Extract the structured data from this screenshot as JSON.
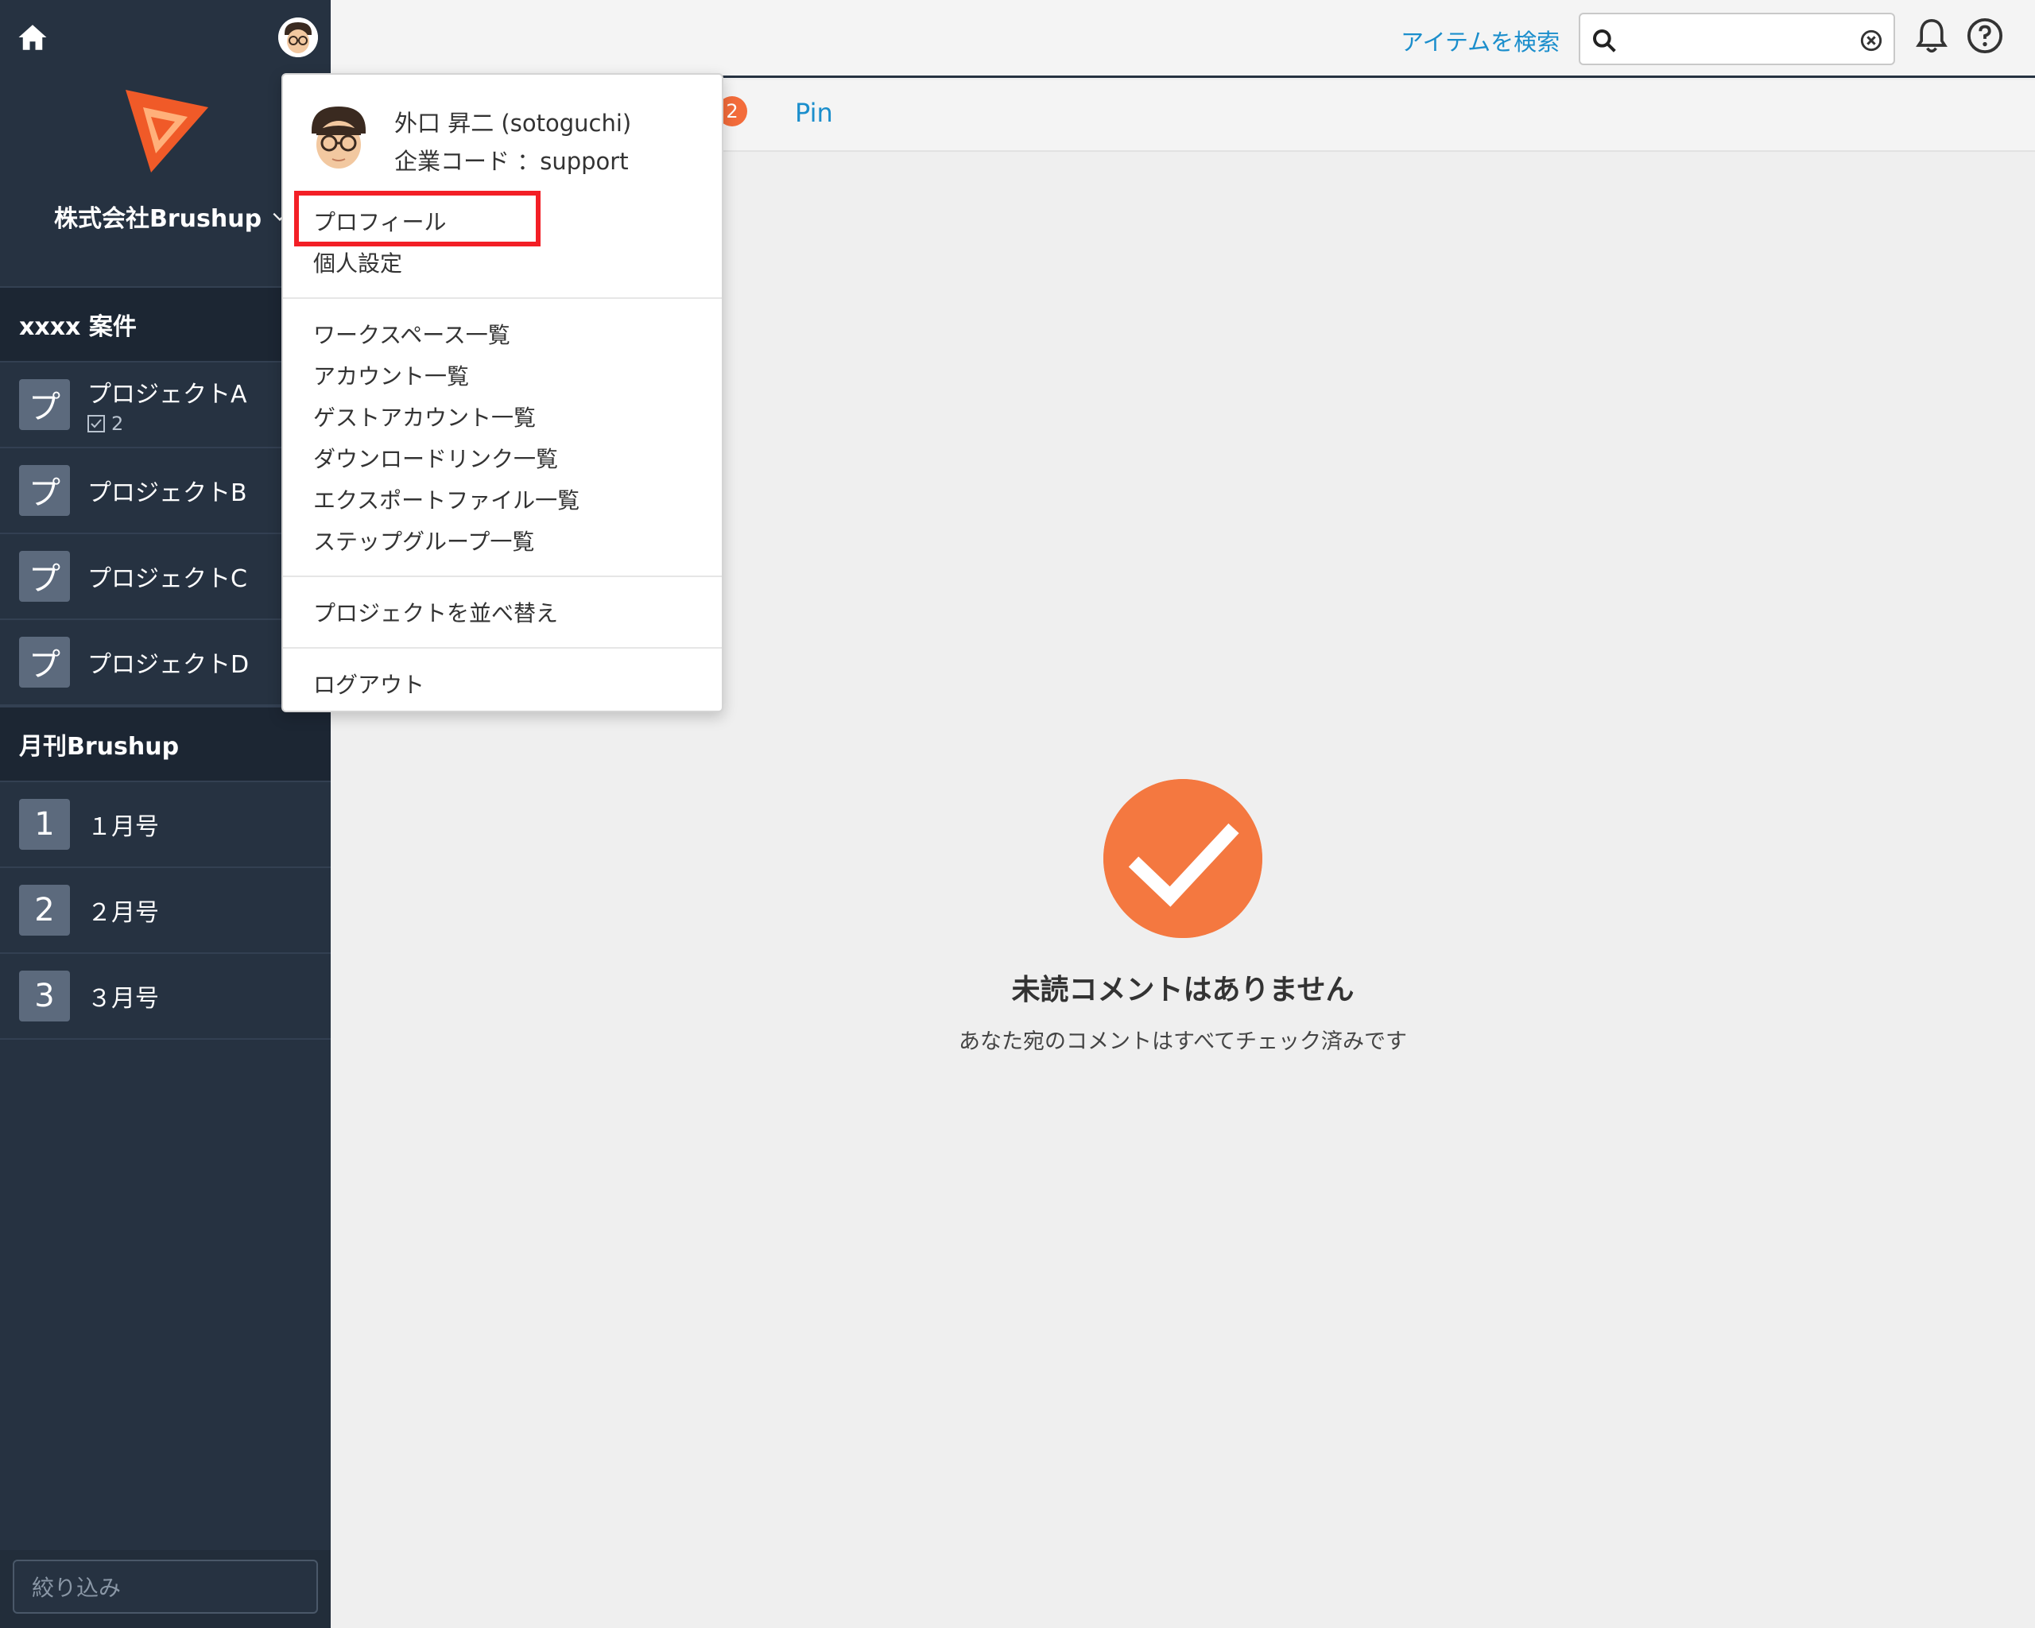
{
  "header": {
    "search_link": "アイテムを検索",
    "search": {
      "value": "",
      "placeholder": ""
    }
  },
  "sidebar": {
    "company": "株式会社Brushup",
    "sections": [
      {
        "title": "xxxx 案件",
        "items": [
          {
            "badge": "プ",
            "label": "プロジェクトA",
            "sub_count": "2"
          },
          {
            "badge": "プ",
            "label": "プロジェクトB"
          },
          {
            "badge": "プ",
            "label": "プロジェクトC"
          },
          {
            "badge": "プ",
            "label": "プロジェクトD"
          }
        ]
      },
      {
        "title": "月刊Brushup",
        "items": [
          {
            "badge": "1",
            "label": "１月号"
          },
          {
            "badge": "2",
            "label": "２月号"
          },
          {
            "badge": "3",
            "label": "３月号"
          }
        ]
      }
    ],
    "filter": {
      "placeholder": "絞り込み"
    }
  },
  "tabs": {
    "count": "2",
    "pin": "Pin"
  },
  "empty_state": {
    "title": "未読コメントはありません",
    "subtitle": "あなた宛のコメントはすべてチェック済みです"
  },
  "user_menu": {
    "name": "外口 昇二 (sotoguchi)",
    "company_code": "企業コード ：support",
    "items": {
      "profile": "プロフィール",
      "personal_settings": "個人設定",
      "workspaces": "ワークスペース一覧",
      "accounts": "アカウント一覧",
      "guest_accounts": "ゲストアカウント一覧",
      "download_links": "ダウンロードリンク一覧",
      "export_files": "エクスポートファイル一覧",
      "step_groups": "ステップグループ一覧",
      "sort_projects": "プロジェクトを並べ替え",
      "logout": "ログアウト"
    }
  },
  "colors": {
    "sidebar": "#263241",
    "accent_link": "#1b8ecc",
    "check_orange": "#f47840",
    "highlight": "#f31f26"
  }
}
